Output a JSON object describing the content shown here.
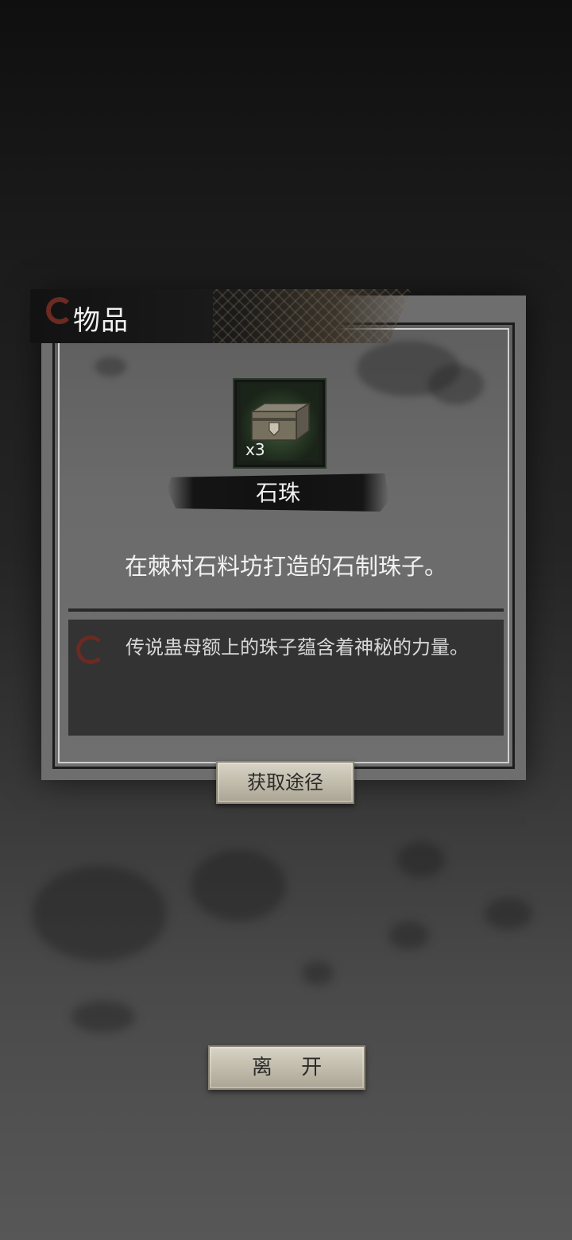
{
  "header": {
    "title": "物品"
  },
  "item": {
    "count_label": "x3",
    "name": "石珠",
    "description": "在棘村石料坊打造的石制珠子。",
    "lore": "传说蛊母额上的珠子蕴含着神秘的力量。",
    "icon": "stone-chest-icon"
  },
  "buttons": {
    "source_label": "获取途径",
    "leave_label": "离 开"
  },
  "colors": {
    "accent_red": "#6b2a22",
    "button_bg": "#c9c4b4",
    "panel_bg": "#6b6b6b"
  }
}
